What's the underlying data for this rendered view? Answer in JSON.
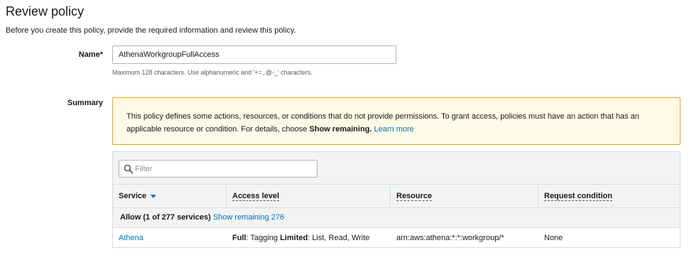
{
  "page": {
    "title": "Review policy",
    "description": "Before you create this policy, provide the required information and review this policy."
  },
  "name_field": {
    "label": "Name*",
    "value": "AthenaWorkgroupFullAccess",
    "hint": "Maximum 128 characters. Use alphanumeric and '+=,.@-_' characters."
  },
  "summary": {
    "label": "Summary",
    "warning": {
      "text": "This policy defines some actions, resources, or conditions that do not provide permissions. To grant access, policies must have an action that has an applicable resource or condition. For details, choose ",
      "bold": "Show remaining.",
      "link": "Learn more"
    }
  },
  "table": {
    "filter_placeholder": "Filter",
    "columns": [
      "Service",
      "Access level",
      "Resource",
      "Request condition"
    ],
    "group": {
      "label": "Allow (1 of 277 services)",
      "link": "Show remaining 276"
    },
    "rows": [
      {
        "service": "Athena",
        "access_full_label": "Full",
        "access_full_value": ": Tagging ",
        "access_limited_label": "Limited",
        "access_limited_value": ": List, Read, Write",
        "resource": "arn:aws:athena:*:*:workgroup/*",
        "condition": "None"
      }
    ]
  },
  "colors": {
    "link": "#0073bb",
    "warning_bg": "#fffae6",
    "warning_border": "#e8a317"
  }
}
